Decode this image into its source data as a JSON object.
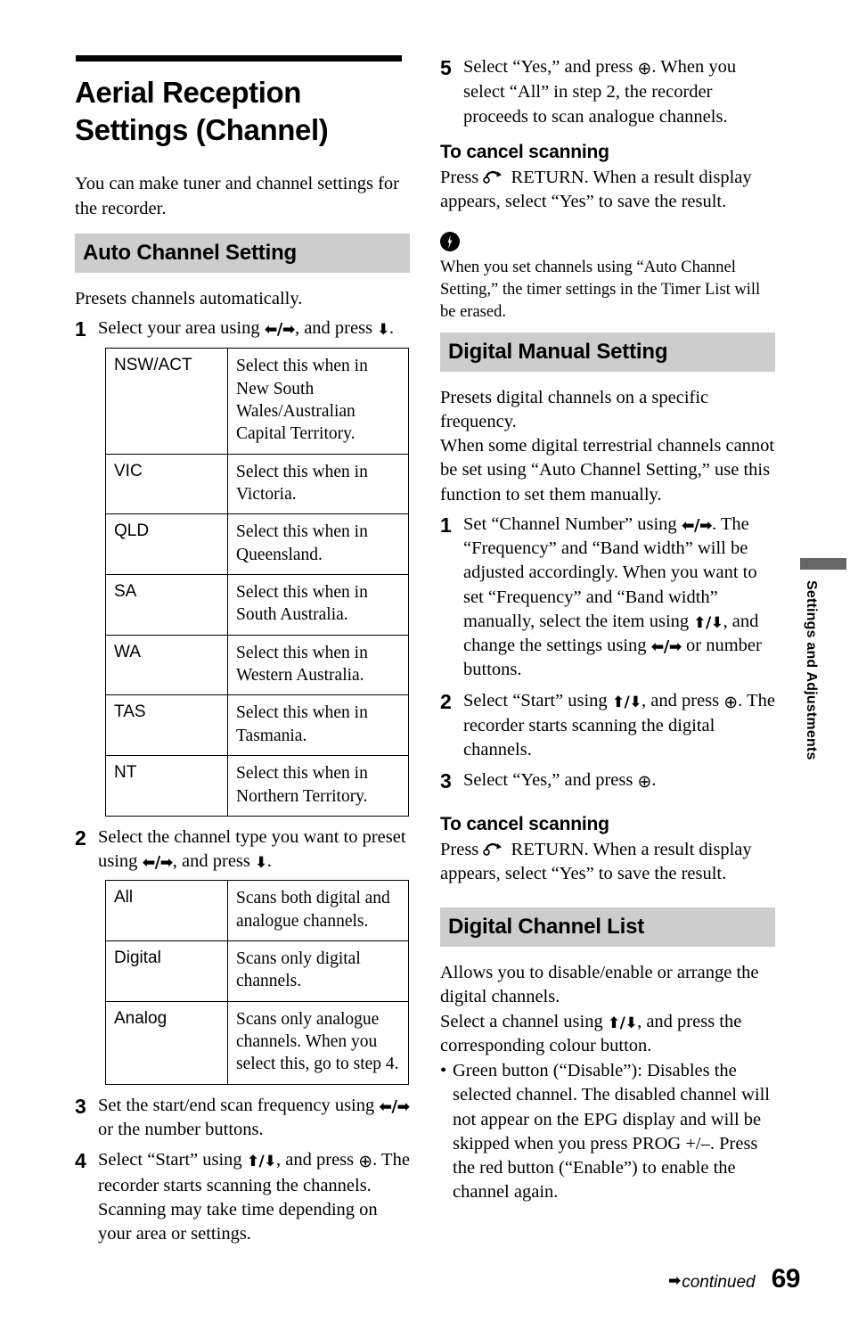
{
  "page": {
    "title": "Aerial Reception Settings (Channel)",
    "intro": "You can make tuner and channel settings for the recorder.",
    "page_number": "69",
    "continued_label": "continued",
    "continued_arrow": "➡",
    "side_tab_label": "Settings and Adjustments"
  },
  "glyphs": {
    "arrow_left_right": "⬅/➡",
    "arrow_up_down": "⬆/⬇",
    "arrow_down": "⬇",
    "arrow_right": "➡",
    "arrow_left_slash": "⬅/",
    "enter": "⊕"
  },
  "left_column": {
    "section": {
      "heading": "Auto Channel Setting",
      "intro": "Presets channels automatically."
    },
    "steps": [
      {
        "num": "1",
        "text_before": "Select your area using ",
        "glyph": "⬅/➡",
        "text_after": ", and press ",
        "glyph2": "⬇",
        "text_end": "."
      },
      {
        "num": "2",
        "text_before": "Select the channel type you want to preset using ",
        "glyph": "⬅/➡",
        "text_after": ", and press ",
        "glyph2": "⬇",
        "text_end": "."
      },
      {
        "num": "3",
        "text_before": "Set the start/end scan frequency using ",
        "glyph": "⬅/➡",
        "text_after": " or the number buttons.",
        "glyph2": "",
        "text_end": ""
      },
      {
        "num": "4",
        "text_before": "Select “Start” using ",
        "glyph": "⬆/⬇",
        "text_after": ", and press ",
        "glyph2": "⊕",
        "text_end": ". The recorder starts scanning the channels. Scanning may take time depending on your area or settings."
      }
    ],
    "area_table": [
      {
        "key": "NSW/ACT",
        "value": "Select this when in New South Wales/Australian Capital Territory."
      },
      {
        "key": "VIC",
        "value": "Select this when in Victoria."
      },
      {
        "key": "QLD",
        "value": "Select this when in Queensland."
      },
      {
        "key": "SA",
        "value": "Select this when in South Australia."
      },
      {
        "key": "WA",
        "value": "Select this when in Western Australia."
      },
      {
        "key": "TAS",
        "value": "Select this when in Tasmania."
      },
      {
        "key": "NT",
        "value": "Select this when in Northern Territory."
      }
    ],
    "channel_type_table": [
      {
        "key": "All",
        "value": "Scans both digital and analogue channels."
      },
      {
        "key": "Digital",
        "value": "Scans only digital channels."
      },
      {
        "key": "Analog",
        "value": "Scans only analogue channels. When you select this, go to step 4."
      }
    ]
  },
  "right_column": {
    "step5": {
      "num": "5",
      "text_before": "Select “Yes,” and press ",
      "glyph": "⊕",
      "text_after": ". When you select “All” in step 2, the recorder proceeds to scan analogue channels."
    },
    "cancel_scanning_1": {
      "heading": "To cancel scanning",
      "text_before": "Press ",
      "icon": "return-icon",
      "text_after": " RETURN. When a result display appears, select “Yes” to save the result."
    },
    "note": {
      "icon": "note-lightning-icon",
      "text": "When you set channels using “Auto Channel Setting,” the timer settings in the Timer List will be erased."
    },
    "digital_manual": {
      "heading": "Digital Manual Setting",
      "intro": "Presets digital channels on a specific frequency.\nWhen some digital terrestrial channels cannot be set using “Auto Channel Setting,” use this function to set them manually.",
      "steps": [
        {
          "num": "1",
          "p1": "Set “Channel Number” using ",
          "g1": "⬅/➡",
          "p2": ". The “Frequency” and “Band width” will be adjusted accordingly. When you want to set “Frequency” and “Band width” manually, select the item using ",
          "g2": "⬆/⬇",
          "p3": ", and change the settings using ",
          "g3": "⬅/➡",
          "p4": " or number buttons."
        },
        {
          "num": "2",
          "p1": "Select “Start” using ",
          "g1": "⬆/⬇",
          "p2": ", and press ",
          "g2": "⊕",
          "p3": ". The recorder starts scanning the digital channels.",
          "g3": "",
          "p4": ""
        },
        {
          "num": "3",
          "p1": "Select “Yes,” and press ",
          "g1": "⊕",
          "p2": ".",
          "g2": "",
          "p3": "",
          "g3": "",
          "p4": ""
        }
      ]
    },
    "cancel_scanning_2": {
      "heading": "To cancel scanning",
      "text_before": "Press ",
      "icon": "return-icon",
      "text_after": " RETURN. When a result display appears, select “Yes” to save the result."
    },
    "digital_channel_list": {
      "heading": "Digital Channel List",
      "intro": "Allows you to disable/enable or arrange the digital channels.",
      "select_before": "Select a channel using ",
      "select_glyph": "⬆/⬇",
      "select_after": ", and press the corresponding colour button.",
      "bullet_dot": "•",
      "bullet_text": "Green button (“Disable”): Disables the selected channel. The disabled channel will not appear on the EPG display and will be skipped when you press PROG +/–. Press the red button (“Enable”) to enable the channel again."
    }
  }
}
